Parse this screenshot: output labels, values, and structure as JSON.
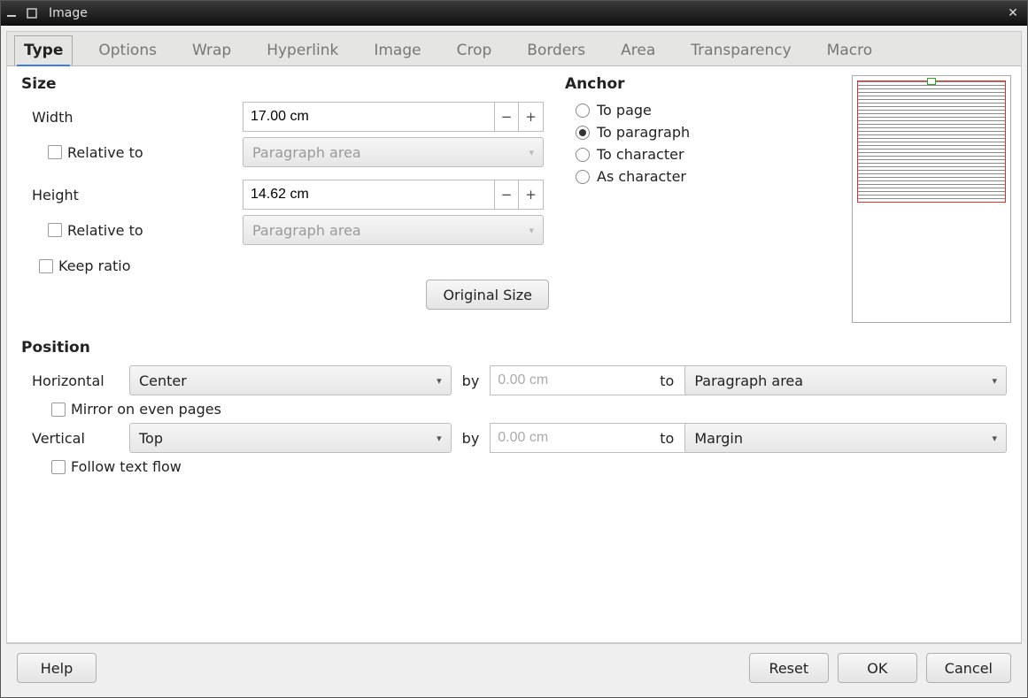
{
  "window": {
    "title": "Image"
  },
  "tabs": [
    "Type",
    "Options",
    "Wrap",
    "Hyperlink",
    "Image",
    "Crop",
    "Borders",
    "Area",
    "Transparency",
    "Macro"
  ],
  "active_tab": "Type",
  "size": {
    "heading": "Size",
    "width_label": "Width",
    "width_value": "17.00 cm",
    "height_label": "Height",
    "height_value": "14.62 cm",
    "relative_label": "Relative to",
    "relative_width_option": "Paragraph area",
    "relative_height_option": "Paragraph area",
    "keep_ratio_label": "Keep ratio",
    "original_size_label": "Original Size"
  },
  "anchor": {
    "heading": "Anchor",
    "options": [
      "To page",
      "To paragraph",
      "To character",
      "As character"
    ],
    "selected": "To paragraph"
  },
  "position": {
    "heading": "Position",
    "horizontal_label": "Horizontal",
    "horizontal_value": "Center",
    "horizontal_by": "0.00 cm",
    "horizontal_ref": "Paragraph area",
    "vertical_label": "Vertical",
    "vertical_value": "Top",
    "vertical_by": "0.00 cm",
    "vertical_ref": "Margin",
    "by_label": "by",
    "to_label": "to",
    "mirror_label": "Mirror on even pages",
    "follow_label": "Follow text flow"
  },
  "buttons": {
    "help": "Help",
    "reset": "Reset",
    "ok": "OK",
    "cancel": "Cancel"
  },
  "symbols": {
    "minus": "−",
    "plus": "+",
    "chevron": "▾",
    "close": "✕"
  }
}
